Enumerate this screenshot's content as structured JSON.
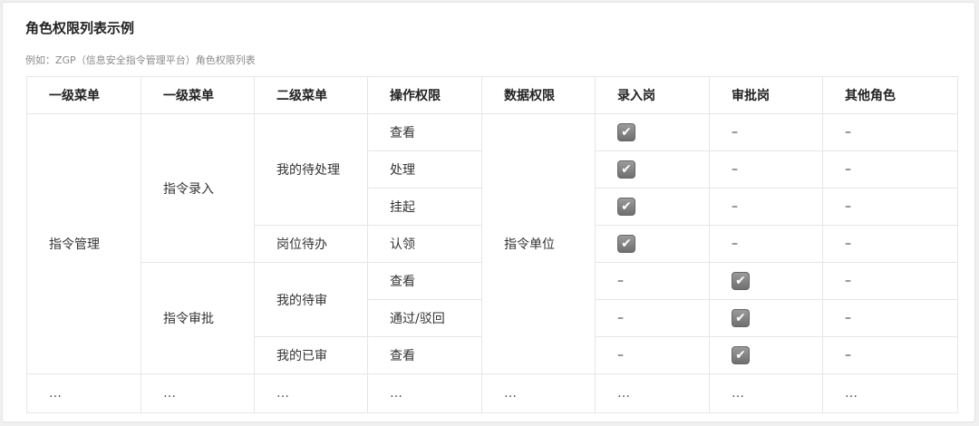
{
  "title": "角色权限列表示例",
  "subtitle": "例如：ZGP（信息安全指令管理平台）角色权限列表",
  "table": {
    "headers": [
      "一级菜单",
      "一级菜单",
      "二级菜单",
      "操作权限",
      "数据权限",
      "录入岗",
      "审批岗",
      "其他角色"
    ],
    "menu1": "指令管理",
    "menu2": [
      "指令录入",
      "指令审批"
    ],
    "menu3": [
      "我的待处理",
      "岗位待办",
      "我的待审",
      "我的已审"
    ],
    "data_scope": "指令单位",
    "operations": [
      "查看",
      "处理",
      "挂起",
      "认领",
      "查看",
      "通过/驳回",
      "查看"
    ],
    "checkmark_glyph": "✔",
    "dash": "–",
    "ellipsis": "…",
    "permissions": [
      {
        "entry": true,
        "approval": false,
        "other": false
      },
      {
        "entry": true,
        "approval": false,
        "other": false
      },
      {
        "entry": true,
        "approval": false,
        "other": false
      },
      {
        "entry": true,
        "approval": false,
        "other": false
      },
      {
        "entry": false,
        "approval": true,
        "other": false
      },
      {
        "entry": false,
        "approval": true,
        "other": false
      },
      {
        "entry": false,
        "approval": true,
        "other": false
      }
    ]
  }
}
